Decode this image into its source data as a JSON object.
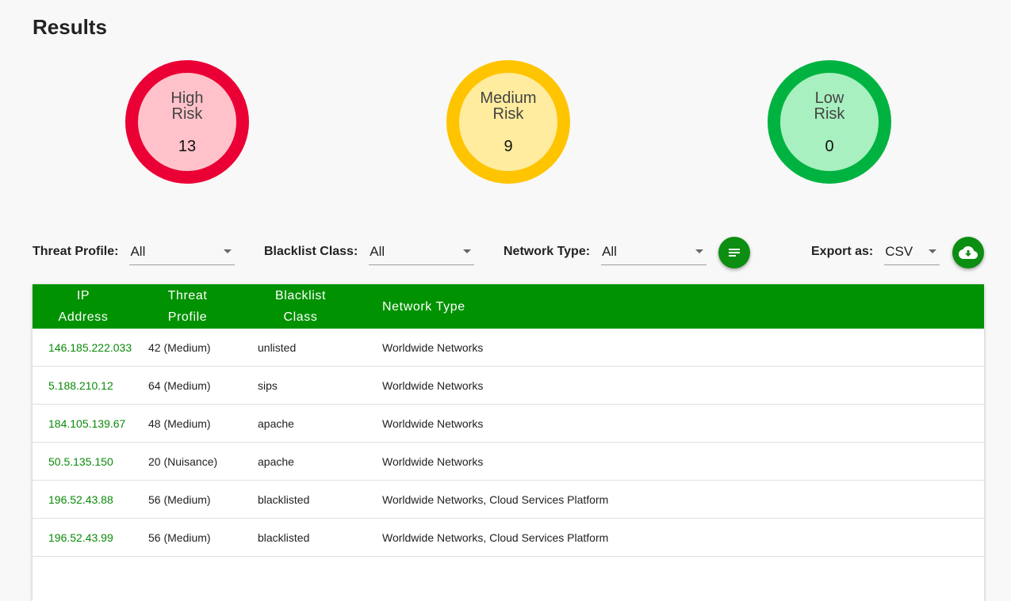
{
  "page_title": "Results",
  "risk": {
    "high": {
      "label_line1": "High",
      "label_line2": "Risk",
      "count": "13",
      "color": "#ea0034"
    },
    "medium": {
      "label_line1": "Medium",
      "label_line2": "Risk",
      "count": "9",
      "color": "#ffc400"
    },
    "low": {
      "label_line1": "Low",
      "label_line2": "Risk",
      "count": "0",
      "color": "#00b341"
    }
  },
  "filters": {
    "threat_profile": {
      "label": "Threat Profile:",
      "value": "All"
    },
    "blacklist_class": {
      "label": "Blacklist Class:",
      "value": "All"
    },
    "network_type": {
      "label": "Network Type:",
      "value": "All"
    },
    "export_as": {
      "label": "Export as:",
      "value": "CSV"
    }
  },
  "icons": {
    "sort": "sort-lines-icon",
    "download": "cloud-download-icon"
  },
  "accent_color": "#009200",
  "table": {
    "headers": {
      "ip_line1": "IP",
      "ip_line2": "Address",
      "threat_line1": "Threat",
      "threat_line2": "Profile",
      "blacklist_line1": "Blacklist",
      "blacklist_line2": "Class",
      "network": "Network Type"
    },
    "rows": [
      {
        "ip": "146.185.222.033",
        "threat": "42 (Medium)",
        "blacklist": "unlisted",
        "network": "Worldwide Networks"
      },
      {
        "ip": "5.188.210.12",
        "threat": "64 (Medium)",
        "blacklist": "sips",
        "network": "Worldwide Networks"
      },
      {
        "ip": "184.105.139.67",
        "threat": "48 (Medium)",
        "blacklist": "apache",
        "network": "Worldwide Networks"
      },
      {
        "ip": "50.5.135.150",
        "threat": "20 (Nuisance)",
        "blacklist": "apache",
        "network": "Worldwide Networks"
      },
      {
        "ip": "196.52.43.88",
        "threat": "56 (Medium)",
        "blacklist": "blacklisted",
        "network": "Worldwide Networks, Cloud Services Platform"
      },
      {
        "ip": "196.52.43.99",
        "threat": "56 (Medium)",
        "blacklist": "blacklisted",
        "network": "Worldwide Networks, Cloud Services Platform"
      }
    ]
  }
}
